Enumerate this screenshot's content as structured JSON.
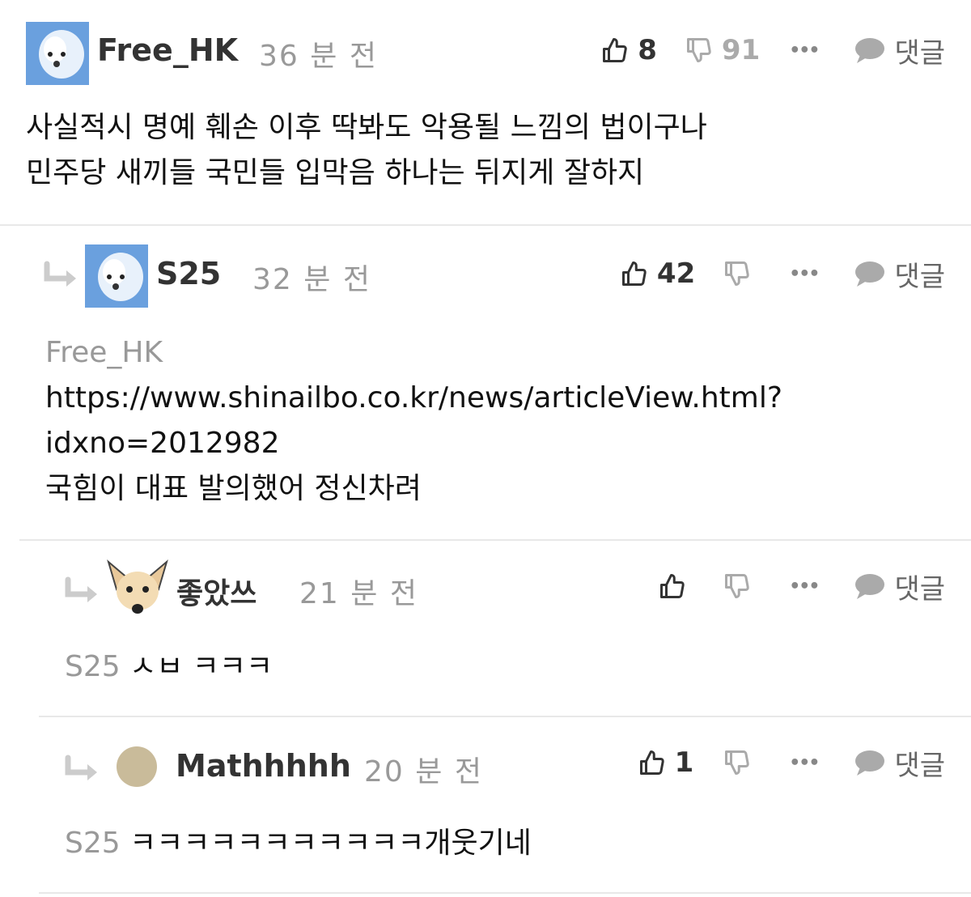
{
  "comments": [
    {
      "author": "Free_HK",
      "time": "36 분 전",
      "likes": "8",
      "dislikes": "91",
      "more": "•••",
      "reply_label": "댓글",
      "lines": [
        "사실적시 명예 훼손 이후 딱봐도 악용될 느낌의 법이구나",
        "민주당 새끼들 국민들 입막음 하나는 뒤지게 잘하지"
      ]
    },
    {
      "author": "S25",
      "time": "32 분 전",
      "likes": "42",
      "more": "•••",
      "reply_label": "댓글",
      "quote_to": "Free_HK",
      "lines": [
        "https://www.shinailbo.co.kr/news/articleView.html?",
        "idxno=2012982",
        "국힘이 대표 발의했어 정신차려"
      ]
    },
    {
      "author": "좋았쓰",
      "time": "21 분 전",
      "more": "•••",
      "reply_label": "댓글",
      "quote_to": "S25",
      "text": " ㅅㅂ ㅋㅋㅋ"
    },
    {
      "author": "Mathhhhh",
      "time": "20 분 전",
      "likes": "1",
      "more": "•••",
      "reply_label": "댓글",
      "quote_to": "S25",
      "text": " ㅋㅋㅋㅋㅋㅋㅋㅋㅋㅋㅋ개웃기네"
    }
  ],
  "colors": {
    "text": "#111111",
    "muted": "#999999",
    "divider": "#e8e8e8",
    "icon": "#333333"
  }
}
